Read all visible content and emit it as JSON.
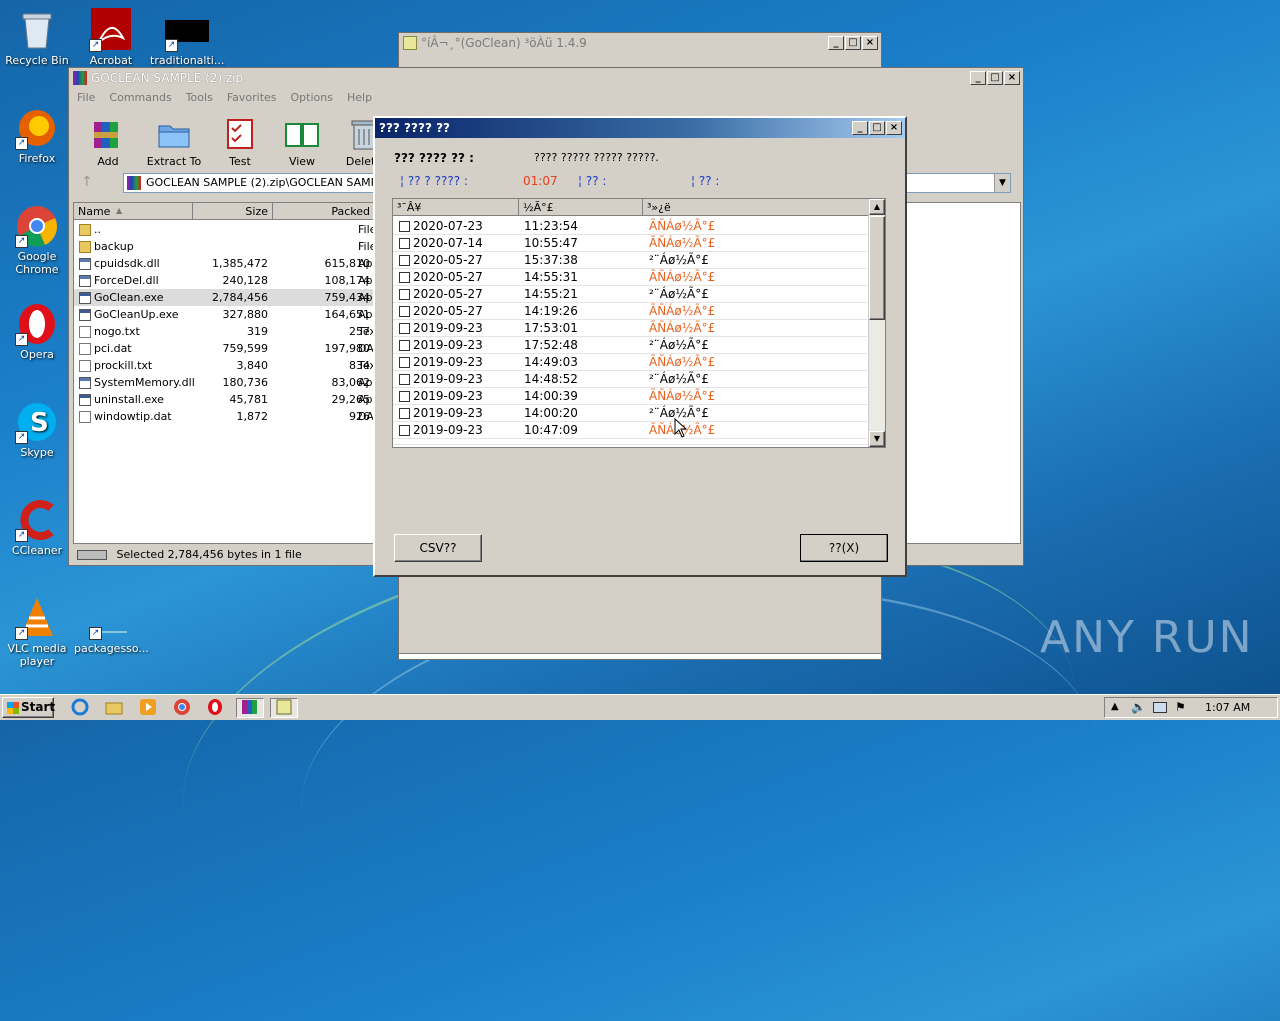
{
  "desktop": {
    "icons": [
      {
        "label": "Recycle Bin",
        "icon": "recycle-bin-icon"
      },
      {
        "label": "Acrobat",
        "icon": "acrobat-icon"
      },
      {
        "label": "traditionalti...",
        "icon": "black-file-icon"
      },
      {
        "label": "Firefox",
        "icon": "firefox-icon"
      },
      {
        "label": "Google Chrome",
        "icon": "chrome-icon"
      },
      {
        "label": "Opera",
        "icon": "opera-icon"
      },
      {
        "label": "Skype",
        "icon": "skype-icon"
      },
      {
        "label": "CCleaner",
        "icon": "ccleaner-icon"
      },
      {
        "label": "VLC media player",
        "icon": "vlc-icon"
      },
      {
        "label": "packagesso...",
        "icon": "blank-file-icon"
      }
    ],
    "watermark": "ANY RUN"
  },
  "goclean_window": {
    "title": "°íÂ¬¸°(GoClean) ³öÀü 1.4.9"
  },
  "winrar": {
    "title": "GOCLEAN SAMPLE (2).zip",
    "menu": [
      "File",
      "Commands",
      "Tools",
      "Favorites",
      "Options",
      "Help"
    ],
    "toolbar": [
      "Add",
      "Extract To",
      "Test",
      "View",
      "Delete"
    ],
    "path": "GOCLEAN SAMPLE (2).zip\\GOCLEAN SAMPLE - Z",
    "columns": [
      "Name",
      "Size",
      "Packed",
      "Typ"
    ],
    "files": [
      {
        "name": "..",
        "size": "",
        "packed": "",
        "type": "File",
        "icon": "folder-up-icon"
      },
      {
        "name": "backup",
        "size": "",
        "packed": "",
        "type": "File",
        "icon": "folder-icon"
      },
      {
        "name": "cpuidsdk.dll",
        "size": "1,385,472",
        "packed": "615,810",
        "type": "App",
        "icon": "dll-icon"
      },
      {
        "name": "ForceDel.dll",
        "size": "240,128",
        "packed": "108,174",
        "type": "App",
        "icon": "dll-icon"
      },
      {
        "name": "GoClean.exe",
        "size": "2,784,456",
        "packed": "759,434",
        "type": "App",
        "icon": "exe-icon"
      },
      {
        "name": "GoCleanUp.exe",
        "size": "327,880",
        "packed": "164,651",
        "type": "App",
        "icon": "exe-icon"
      },
      {
        "name": "nogo.txt",
        "size": "319",
        "packed": "257",
        "type": "Tex",
        "icon": "txt-icon"
      },
      {
        "name": "pci.dat",
        "size": "759,599",
        "packed": "197,980",
        "type": "DA",
        "icon": "dat-icon"
      },
      {
        "name": "prockill.txt",
        "size": "3,840",
        "packed": "834",
        "type": "Tex",
        "icon": "txt-icon"
      },
      {
        "name": "SystemMemory.dll",
        "size": "180,736",
        "packed": "83,062",
        "type": "App",
        "icon": "dll-icon"
      },
      {
        "name": "uninstall.exe",
        "size": "45,781",
        "packed": "29,265",
        "type": "App",
        "icon": "exe-icon"
      },
      {
        "name": "windowtip.dat",
        "size": "1,872",
        "packed": "926",
        "type": "DA",
        "icon": "dat-icon"
      }
    ],
    "status": "Selected 2,784,456 bytes in 1 file"
  },
  "dialog": {
    "title": "??? ???? ??",
    "header_label": "??? ???? ?? :",
    "header_value": "???? ????? ????? ?????.",
    "info1_label": "¦ ?? ? ???? :",
    "info1_value": "01:07",
    "info2_label": "¦ ?? :",
    "info3_label": "¦ ?? :",
    "columns": [
      "³¯Â¥",
      "½Ã°£",
      "³»¿ë"
    ],
    "rows": [
      {
        "date": "2020-07-23",
        "time": "11:23:54",
        "content": "ÃÑÁø½Ã°£",
        "kind": "orange"
      },
      {
        "date": "2020-07-14",
        "time": "10:55:47",
        "content": "ÃÑÁø½Ã°£",
        "kind": "orange"
      },
      {
        "date": "2020-05-27",
        "time": "15:37:38",
        "content": "²¨Áø½Ã°£",
        "kind": "black"
      },
      {
        "date": "2020-05-27",
        "time": "14:55:31",
        "content": "ÃÑÁø½Ã°£",
        "kind": "orange"
      },
      {
        "date": "2020-05-27",
        "time": "14:55:21",
        "content": "²¨Áø½Ã°£",
        "kind": "black"
      },
      {
        "date": "2020-05-27",
        "time": "14:19:26",
        "content": "ÃÑÁø½Ã°£",
        "kind": "orange"
      },
      {
        "date": "2019-09-23",
        "time": "17:53:01",
        "content": "ÃÑÁø½Ã°£",
        "kind": "orange"
      },
      {
        "date": "2019-09-23",
        "time": "17:52:48",
        "content": "²¨Áø½Ã°£",
        "kind": "black"
      },
      {
        "date": "2019-09-23",
        "time": "14:49:03",
        "content": "ÃÑÁø½Ã°£",
        "kind": "orange"
      },
      {
        "date": "2019-09-23",
        "time": "14:48:52",
        "content": "²¨Áø½Ã°£",
        "kind": "black"
      },
      {
        "date": "2019-09-23",
        "time": "14:00:39",
        "content": "ÃÑÁø½Ã°£",
        "kind": "orange"
      },
      {
        "date": "2019-09-23",
        "time": "14:00:20",
        "content": "²¨Áø½Ã°£",
        "kind": "black"
      },
      {
        "date": "2019-09-23",
        "time": "10:47:09",
        "content": "ÃÑÁø½Ã°£",
        "kind": "orange"
      }
    ],
    "csv_button": "CSV??",
    "close_button": "??(X)"
  },
  "taskbar": {
    "start": "Start",
    "clock": "1:07 AM",
    "apps": [
      "ie-icon",
      "explorer-icon",
      "media-player-icon",
      "chrome-icon",
      "opera-icon",
      "winrar-icon",
      "goclean-icon"
    ]
  },
  "colors": {
    "orange_text": "#e8601c",
    "black_text": "#000000",
    "blue_label": "#1a3cc8",
    "red_value": "#e8401c"
  }
}
